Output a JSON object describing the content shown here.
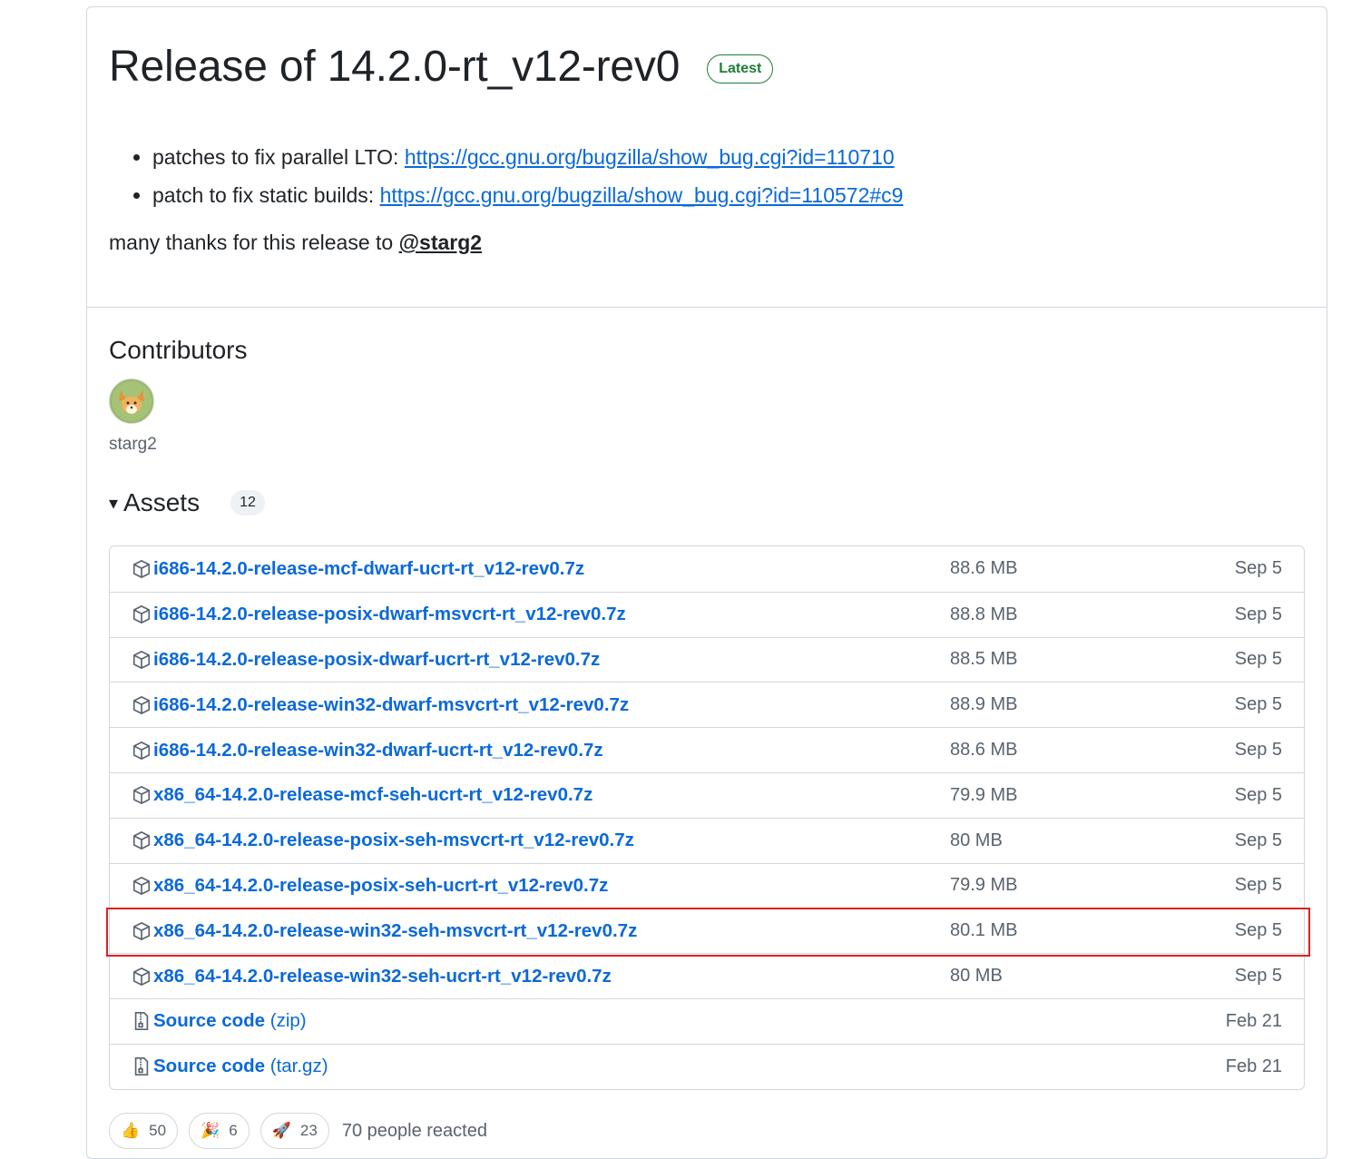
{
  "release": {
    "title": "Release of 14.2.0-rt_v12-rev0",
    "badge": "Latest",
    "notes": [
      {
        "text": "patches to fix parallel LTO: ",
        "link": "https://gcc.gnu.org/bugzilla/show_bug.cgi?id=110710"
      },
      {
        "text": "patch to fix static builds: ",
        "link": "https://gcc.gnu.org/bugzilla/show_bug.cgi?id=110572#c9"
      }
    ],
    "thanks_text": "many thanks for this release to ",
    "thanks_mention": "@starg2"
  },
  "contributors": {
    "title": "Contributors",
    "names": [
      "starg2"
    ]
  },
  "assets": {
    "title": "Assets",
    "count": "12",
    "highlight_color": "#e02020",
    "items": [
      {
        "name": "i686-14.2.0-release-mcf-dwarf-ucrt-rt_v12-rev0.7z",
        "ext": "",
        "size": "88.6 MB",
        "date": "Sep 5",
        "icon": "package-icon"
      },
      {
        "name": "i686-14.2.0-release-posix-dwarf-msvcrt-rt_v12-rev0.7z",
        "ext": "",
        "size": "88.8 MB",
        "date": "Sep 5",
        "icon": "package-icon"
      },
      {
        "name": "i686-14.2.0-release-posix-dwarf-ucrt-rt_v12-rev0.7z",
        "ext": "",
        "size": "88.5 MB",
        "date": "Sep 5",
        "icon": "package-icon"
      },
      {
        "name": "i686-14.2.0-release-win32-dwarf-msvcrt-rt_v12-rev0.7z",
        "ext": "",
        "size": "88.9 MB",
        "date": "Sep 5",
        "icon": "package-icon"
      },
      {
        "name": "i686-14.2.0-release-win32-dwarf-ucrt-rt_v12-rev0.7z",
        "ext": "",
        "size": "88.6 MB",
        "date": "Sep 5",
        "icon": "package-icon"
      },
      {
        "name": "x86_64-14.2.0-release-mcf-seh-ucrt-rt_v12-rev0.7z",
        "ext": "",
        "size": "79.9 MB",
        "date": "Sep 5",
        "icon": "package-icon"
      },
      {
        "name": "x86_64-14.2.0-release-posix-seh-msvcrt-rt_v12-rev0.7z",
        "ext": "",
        "size": "80 MB",
        "date": "Sep 5",
        "icon": "package-icon"
      },
      {
        "name": "x86_64-14.2.0-release-posix-seh-ucrt-rt_v12-rev0.7z",
        "ext": "",
        "size": "79.9 MB",
        "date": "Sep 5",
        "icon": "package-icon"
      },
      {
        "name": "x86_64-14.2.0-release-win32-seh-msvcrt-rt_v12-rev0.7z",
        "ext": "",
        "size": "80.1 MB",
        "date": "Sep 5",
        "icon": "package-icon"
      },
      {
        "name": "x86_64-14.2.0-release-win32-seh-ucrt-rt_v12-rev0.7z",
        "ext": "",
        "size": "80 MB",
        "date": "Sep 5",
        "icon": "package-icon"
      },
      {
        "name": "Source code",
        "ext": " (zip)",
        "size": "",
        "date": "Feb 21",
        "icon": "file-zip-icon"
      },
      {
        "name": "Source code",
        "ext": " (tar.gz)",
        "size": "",
        "date": "Feb 21",
        "icon": "file-zip-icon"
      }
    ]
  },
  "reactions": {
    "items": [
      {
        "emoji": "👍",
        "icon": "thumbs-up-icon",
        "count": "50"
      },
      {
        "emoji": "🎉",
        "icon": "tada-icon",
        "count": "6"
      },
      {
        "emoji": "🚀",
        "icon": "rocket-icon",
        "count": "23"
      }
    ],
    "summary": "70 people reacted"
  }
}
